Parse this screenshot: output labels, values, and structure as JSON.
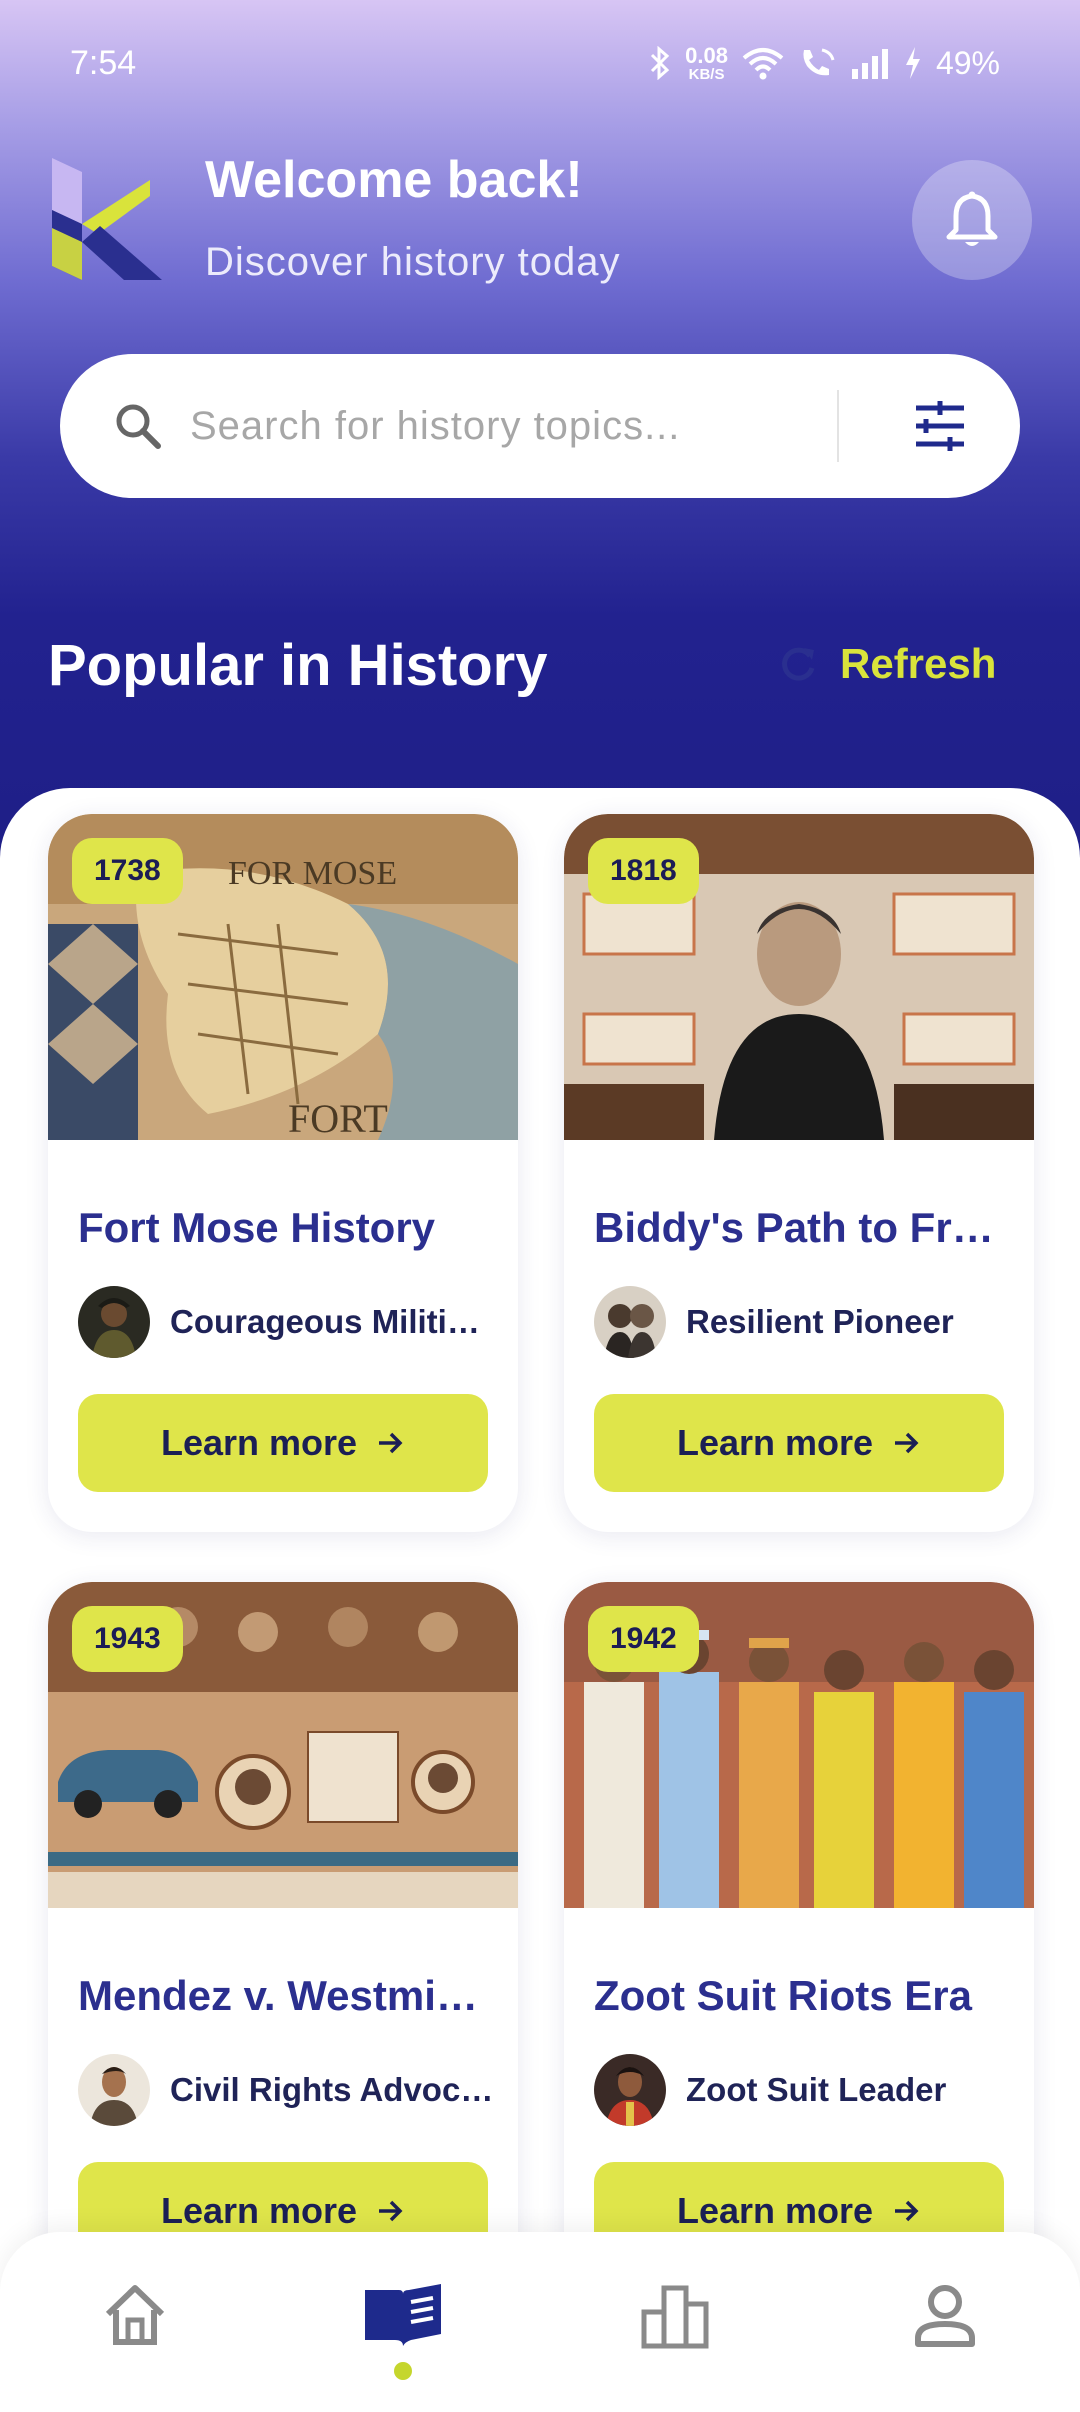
{
  "status_bar": {
    "time": "7:54",
    "net_speed_value": "0.08",
    "net_speed_unit": "KB/S",
    "battery": "49%"
  },
  "header": {
    "welcome": "Welcome back!",
    "subtitle": "Discover history today"
  },
  "search": {
    "placeholder": "Search for history topics..."
  },
  "section": {
    "title": "Popular in History",
    "refresh_label": "Refresh"
  },
  "cards": [
    {
      "year": "1738",
      "title": "Fort Mose History",
      "author": "Courageous Militia Leader",
      "button": "Learn more"
    },
    {
      "year": "1818",
      "title": "Biddy's Path to Freedom",
      "author": "Resilient Pioneer",
      "button": "Learn more"
    },
    {
      "year": "1943",
      "title": "Mendez v. Westminster",
      "author": "Civil Rights Advocate",
      "button": "Learn more"
    },
    {
      "year": "1942",
      "title": "Zoot Suit Riots Era",
      "author": "Zoot Suit Leader",
      "button": "Learn more"
    }
  ],
  "colors": {
    "accent": "#dfe54a",
    "primary": "#2b2f8f",
    "nav_active": "#1e2a8c",
    "nav_inactive": "#8a8a8a"
  },
  "nav": [
    {
      "icon": "home-icon",
      "active": false
    },
    {
      "icon": "book-icon",
      "active": true
    },
    {
      "icon": "leaderboard-icon",
      "active": false
    },
    {
      "icon": "profile-icon",
      "active": false
    }
  ]
}
